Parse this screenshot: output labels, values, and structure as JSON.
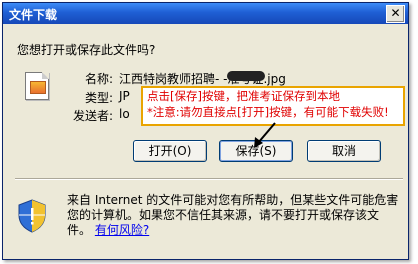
{
  "window": {
    "title": "文件下载",
    "close_glyph": "✕"
  },
  "prompt": "您想打开或保存此文件吗?",
  "file": {
    "name_label": "名称:",
    "name_value": "江西特岗教师招聘-         -准考证.jpg",
    "type_label": "类型:",
    "type_value": "JP",
    "from_label": "发送者:",
    "from_value": "lo"
  },
  "annotation": {
    "line1": "点击[保存]按键，把准考证保存到本地",
    "line2": "*注意:请勿直接点[打开]按键，有可能下载失败!"
  },
  "buttons": {
    "open": "打开(O)",
    "save": "保存(S)",
    "cancel": "取消"
  },
  "warning": {
    "text": "来自 Internet 的文件可能对您有所帮助，但某些文件可能危害您的计算机。如果您不信任其来源，请不要打开或保存该文件。",
    "link": "有何风险?"
  }
}
